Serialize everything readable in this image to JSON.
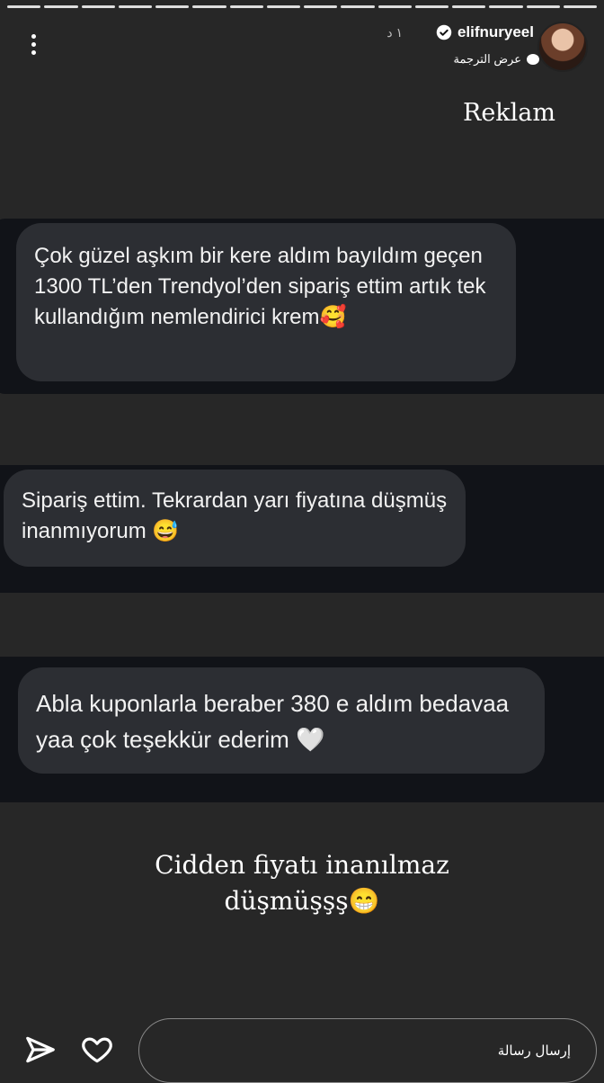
{
  "story": {
    "segments": 16,
    "username": "elifnuryeel",
    "time": "١ د",
    "translate_label": "عرض الترجمة"
  },
  "content": {
    "reklam": "Reklam",
    "messages": [
      "Çok güzel aşkım bir kere aldım bayıldım geçen 1300 TL’den Trendyol’den sipariş ettim artık tek kullandığım nemlendirici krem🥰",
      "Sipariş ettim. Tekrardan yarı fiyatına düşmüş inanmıyorum 😅",
      "Abla kuponlarla beraber 380 e aldım bedavaa yaa çok teşekkür ederim 🤍"
    ],
    "caption_line1": "Cidden fiyatı inanılmaz",
    "caption_line2": "düşmüşşş😁"
  },
  "footer": {
    "message_placeholder": "إرسال رسالة"
  },
  "icons": {
    "menu": "more-vertical-icon",
    "verified": "verified-badge-icon",
    "translate": "chat-bubble-icon",
    "send": "send-icon",
    "like": "heart-icon"
  },
  "colors": {
    "background": "#272727",
    "band": "#111318",
    "bubble": "#2c2e33"
  }
}
